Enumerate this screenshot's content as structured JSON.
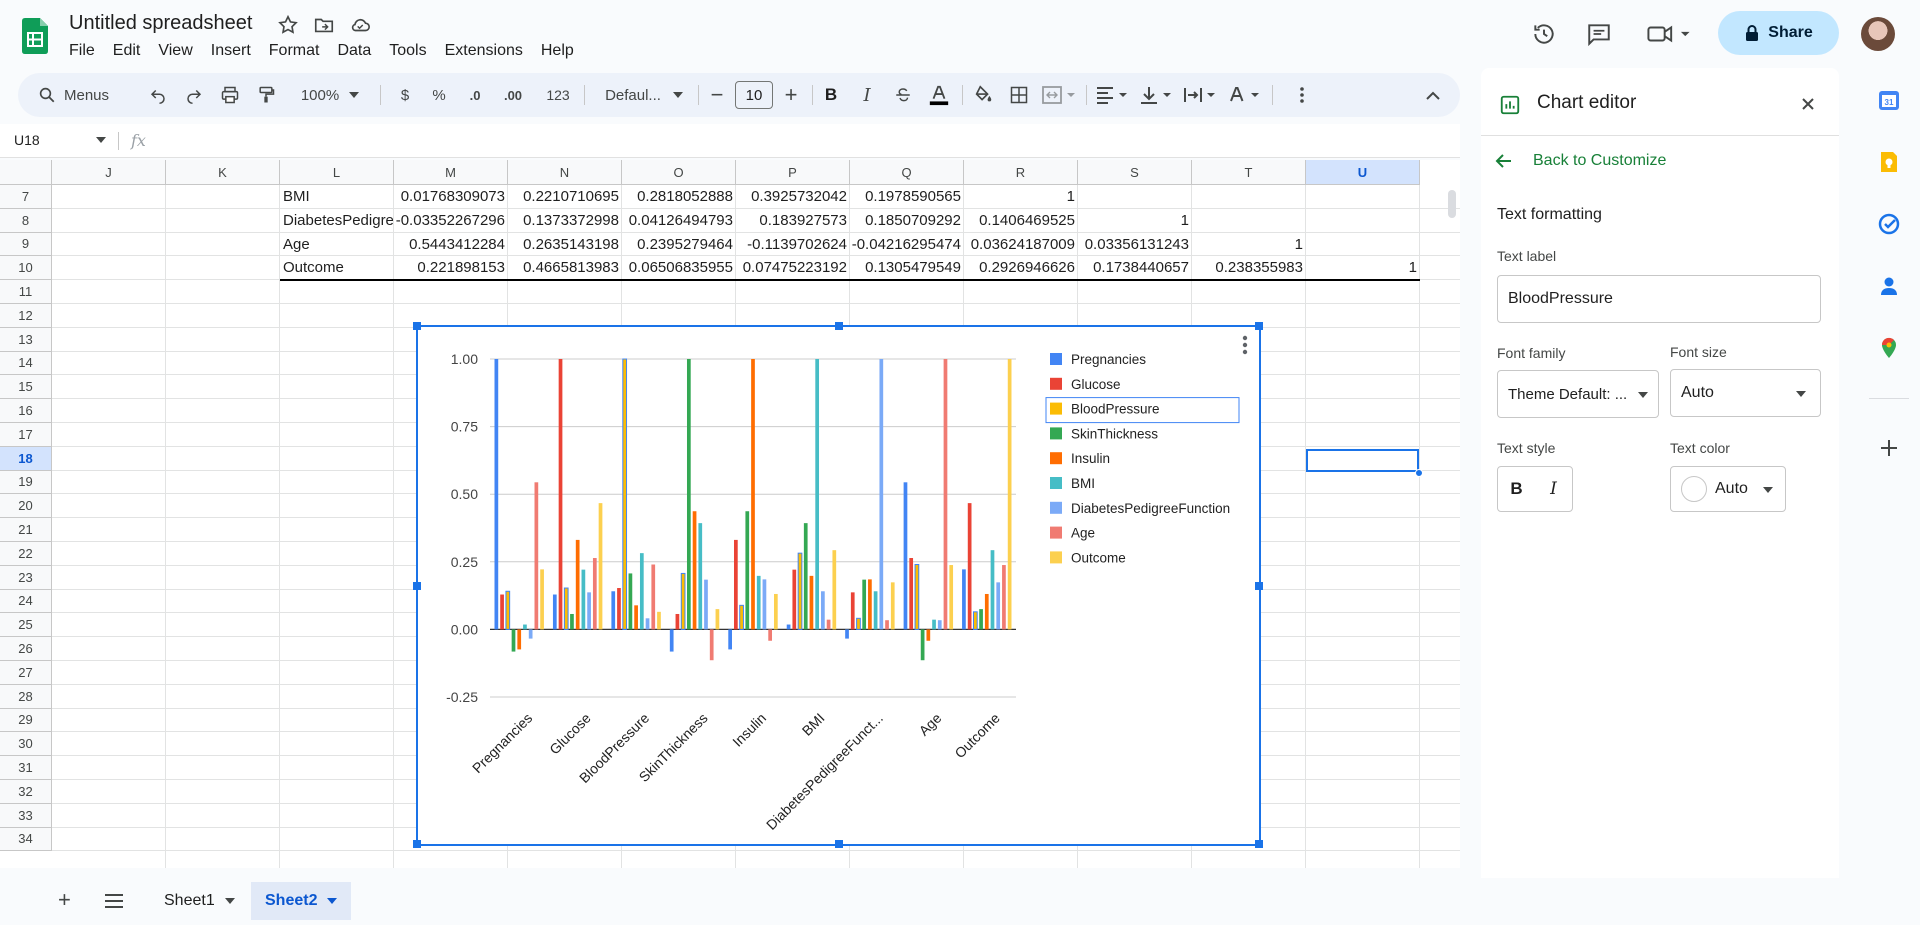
{
  "app": {
    "title": "Untitled spreadsheet",
    "menu": [
      "File",
      "Edit",
      "View",
      "Insert",
      "Format",
      "Data",
      "Tools",
      "Extensions",
      "Help"
    ],
    "share_label": "Share"
  },
  "toolbar": {
    "menus_label": "Menus",
    "zoom": "100%",
    "currency": "$",
    "percent": "%",
    "dec_decrease": ".0",
    "dec_increase": ".00",
    "number_format": "123",
    "font_family": "Defaul...",
    "font_size": "10",
    "bold": "B",
    "italic": "I"
  },
  "formula_bar": {
    "cell_ref": "U18",
    "fx": "fx",
    "value": ""
  },
  "grid": {
    "columns": [
      "J",
      "K",
      "L",
      "M",
      "N",
      "O",
      "P",
      "Q",
      "R",
      "S",
      "T",
      "U"
    ],
    "rows": [
      "7",
      "8",
      "9",
      "10",
      "11",
      "12",
      "13",
      "14",
      "15",
      "16",
      "17",
      "18",
      "19",
      "20",
      "21",
      "22",
      "23",
      "24",
      "25",
      "26",
      "27",
      "28",
      "29",
      "30",
      "31",
      "32",
      "33",
      "34"
    ],
    "data_rows": [
      [
        "BMI",
        "0.01768309073",
        "0.2210710695",
        "0.2818052888",
        "0.3925732042",
        "0.1978590565",
        "1",
        "",
        "",
        ""
      ],
      [
        "DiabetesPedigre",
        "-0.03352267296",
        "0.1373372998",
        "0.04126494793",
        "0.183927573",
        "0.1850709292",
        "0.1406469525",
        "1",
        "",
        ""
      ],
      [
        "Age",
        "0.5443412284",
        "0.2635143198",
        "0.2395279464",
        "-0.1139702624",
        "-0.04216295474",
        "0.03624187009",
        "0.03356131243",
        "1",
        ""
      ],
      [
        "Outcome",
        "0.221898153",
        "0.4665813983",
        "0.06506835955",
        "0.07475223192",
        "0.1305479549",
        "0.2926946626",
        "0.1738440657",
        "0.238355983",
        "1"
      ]
    ]
  },
  "chart_data": {
    "type": "bar",
    "categories": [
      "Pregnancies",
      "Glucose",
      "BloodPressure",
      "SkinThickness",
      "Insulin",
      "BMI",
      "DiabetesPedigreeFunct...",
      "Age",
      "Outcome"
    ],
    "series": [
      {
        "name": "Pregnancies",
        "color": "#4285f4",
        "values": [
          1,
          0.129,
          0.141,
          -0.082,
          -0.074,
          0.018,
          -0.034,
          0.544,
          0.222
        ]
      },
      {
        "name": "Glucose",
        "color": "#ea4335",
        "values": [
          0.129,
          1,
          0.153,
          0.057,
          0.331,
          0.221,
          0.137,
          0.264,
          0.467
        ]
      },
      {
        "name": "BloodPressure",
        "color": "#fbbc04",
        "values": [
          0.141,
          0.153,
          1,
          0.207,
          0.089,
          0.282,
          0.041,
          0.24,
          0.065
        ]
      },
      {
        "name": "SkinThickness",
        "color": "#34a853",
        "values": [
          -0.082,
          0.057,
          0.207,
          1,
          0.437,
          0.393,
          0.184,
          -0.114,
          0.075
        ]
      },
      {
        "name": "Insulin",
        "color": "#ff6d01",
        "values": [
          -0.074,
          0.331,
          0.089,
          0.437,
          1,
          0.198,
          0.185,
          -0.042,
          0.131
        ]
      },
      {
        "name": "BMI",
        "color": "#46bdc6",
        "values": [
          0.018,
          0.221,
          0.282,
          0.393,
          0.198,
          1,
          0.141,
          0.036,
          0.293
        ]
      },
      {
        "name": "DiabetesPedigreeFunction",
        "color": "#7baaf7",
        "values": [
          -0.034,
          0.137,
          0.041,
          0.184,
          0.185,
          0.141,
          1,
          0.034,
          0.174
        ]
      },
      {
        "name": "Age",
        "color": "#f07b72",
        "values": [
          0.544,
          0.264,
          0.24,
          -0.114,
          -0.042,
          0.036,
          0.034,
          1,
          0.238
        ]
      },
      {
        "name": "Outcome",
        "color": "#fcd04f",
        "values": [
          0.222,
          0.467,
          0.065,
          0.075,
          0.131,
          0.293,
          0.174,
          0.238,
          1
        ]
      }
    ],
    "yticks": [
      "1.00",
      "0.75",
      "0.50",
      "0.25",
      "0.00",
      "-0.25"
    ],
    "ylim": [
      -0.25,
      1
    ],
    "legend": "right",
    "selected_series": "BloodPressure"
  },
  "panel": {
    "title": "Chart editor",
    "back_label": "Back to Customize",
    "section": "Text formatting",
    "text_label_caption": "Text label",
    "text_label_value": "BloodPressure",
    "font_family_caption": "Font family",
    "font_family_value": "Theme Default: ...",
    "font_size_caption": "Font size",
    "font_size_value": "Auto",
    "text_style_caption": "Text style",
    "text_color_caption": "Text color",
    "text_color_value": "Auto"
  },
  "sheets": {
    "tabs": [
      "Sheet1",
      "Sheet2"
    ],
    "active": "Sheet2"
  },
  "icons": [
    "star-icon",
    "move-icon",
    "cloud-icon",
    "history-icon",
    "comment-icon",
    "video-icon",
    "lock-icon",
    "search-icon",
    "undo-icon",
    "redo-icon",
    "print-icon",
    "paint-format-icon"
  ]
}
